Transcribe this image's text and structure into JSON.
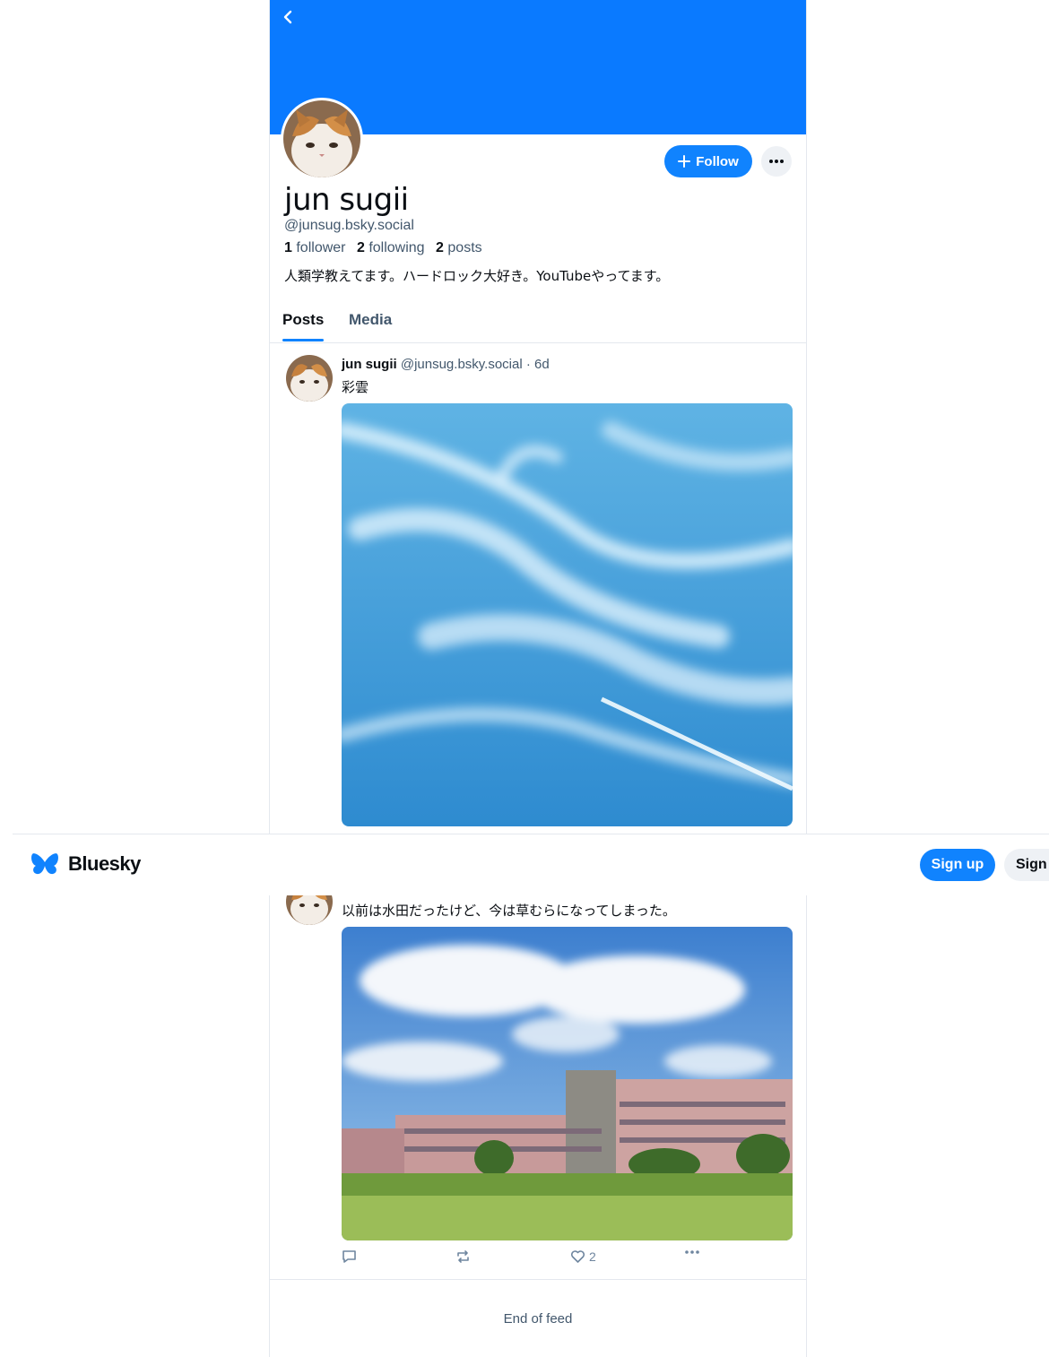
{
  "profile": {
    "display_name": "jun sugii",
    "handle": "@junsug.bsky.social",
    "followers_count": "1",
    "followers_label": "follower",
    "following_count": "2",
    "following_label": "following",
    "posts_count": "2",
    "posts_label": "posts",
    "bio": "人類学教えてます。ハードロック大好き。YouTubeやってます。",
    "follow_label": "Follow"
  },
  "tabs": [
    {
      "label": "Posts",
      "active": true
    },
    {
      "label": "Media",
      "active": false
    }
  ],
  "posts": [
    {
      "author": "jun sugii",
      "handle": "@junsug.bsky.social",
      "separator": "·",
      "time": "6d",
      "text": "彩雲",
      "image": "cloud-sky-photo"
    },
    {
      "text": "以前は水田だったけど、今は草むらになってしまった。",
      "image": "building-field-photo",
      "like_count": "2"
    }
  ],
  "feed_end": "End of feed",
  "bottom_bar": {
    "brand": "Bluesky",
    "signup_label": "Sign up",
    "signin_label": "Sign in"
  },
  "colors": {
    "accent": "#1083fe",
    "banner": "#0a7aff"
  }
}
